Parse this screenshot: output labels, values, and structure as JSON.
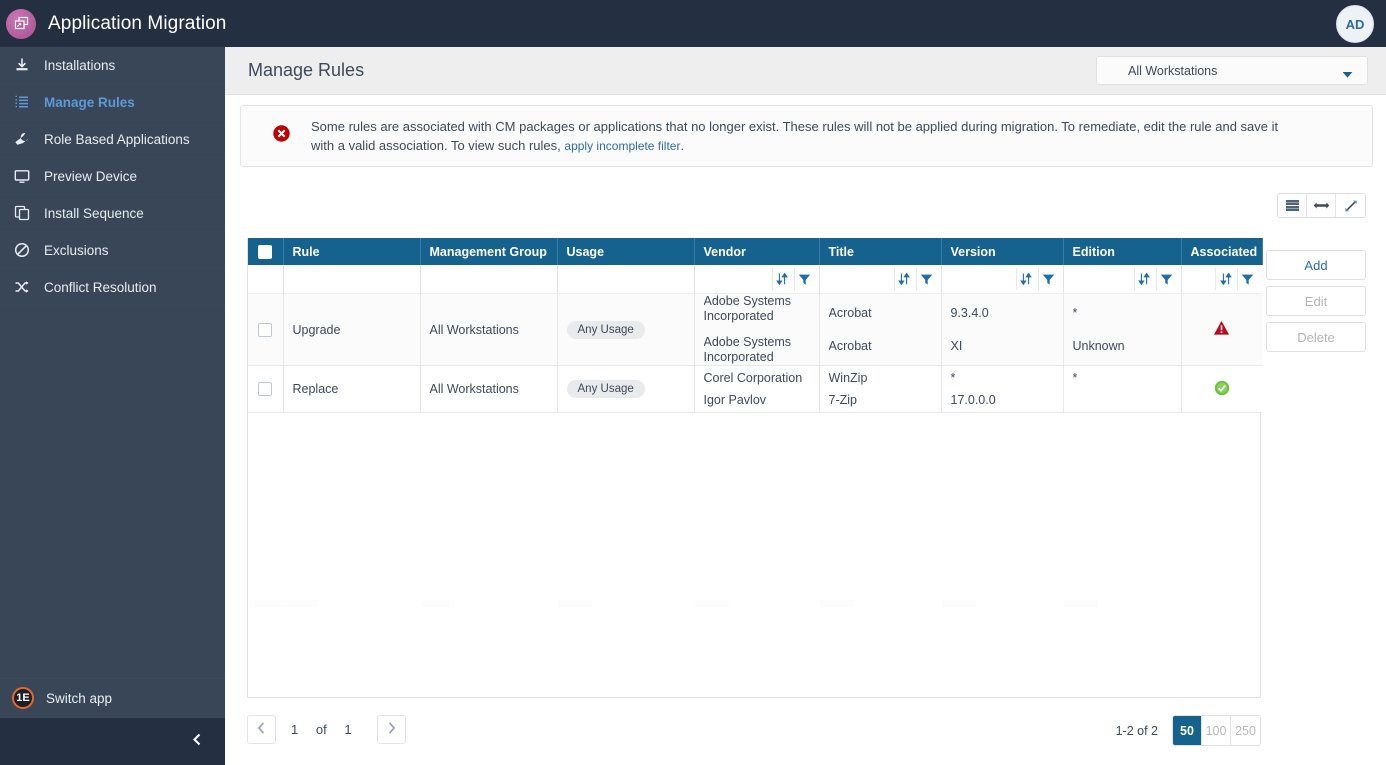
{
  "app": {
    "title": "Application Migration",
    "logo_icon": "app-windows-arrow-icon",
    "avatar_initials": "AD"
  },
  "sidebar": {
    "items": [
      {
        "label": "Installations",
        "icon": "download-icon",
        "active": false
      },
      {
        "label": "Manage Rules",
        "icon": "list-ordered-icon",
        "active": true
      },
      {
        "label": "Role Based Applications",
        "icon": "wrench-icon",
        "active": false
      },
      {
        "label": "Preview Device",
        "icon": "monitor-icon",
        "active": false
      },
      {
        "label": "Install Sequence",
        "icon": "copy-icon",
        "active": false
      },
      {
        "label": "Exclusions",
        "icon": "ban-icon",
        "active": false
      },
      {
        "label": "Conflict Resolution",
        "icon": "shuffle-icon",
        "active": false
      }
    ],
    "switch_app": {
      "label": "Switch app",
      "icon": "one-e-logo-icon",
      "badge": "1E"
    },
    "collapse_icon": "chevron-left-icon"
  },
  "header": {
    "page_title": "Manage Rules",
    "scope_select": {
      "value": "All Workstations",
      "caret_icon": "chevron-down-icon"
    }
  },
  "alert": {
    "icon": "error-circle-icon",
    "message": "Some rules are associated with CM packages or applications that no longer exist. These rules will not be applied during migration. To remediate, edit the rule and save it with a valid association. To view such rules,",
    "link_text": "apply incomplete filter",
    "trailing": "."
  },
  "grid_tools": [
    {
      "name": "column-chooser-icon",
      "icon": "hamburger-lines-icon"
    },
    {
      "name": "fit-columns-icon",
      "icon": "horizontal-arrows-icon"
    },
    {
      "name": "fullscreen-icon",
      "icon": "diagonal-arrows-icon"
    }
  ],
  "actions": [
    {
      "label": "Add",
      "disabled": false
    },
    {
      "label": "Edit",
      "disabled": true
    },
    {
      "label": "Delete",
      "disabled": true
    }
  ],
  "table": {
    "select_all_checkbox": false,
    "columns": [
      {
        "key": "rule",
        "label": "Rule",
        "sortable": false,
        "filterable": false
      },
      {
        "key": "mg",
        "label": "Management Group",
        "sortable": false,
        "filterable": false
      },
      {
        "key": "usage",
        "label": "Usage",
        "sortable": false,
        "filterable": false
      },
      {
        "key": "vendor",
        "label": "Vendor",
        "sortable": true,
        "filterable": true
      },
      {
        "key": "title",
        "label": "Title",
        "sortable": true,
        "filterable": true
      },
      {
        "key": "version",
        "label": "Version",
        "sortable": true,
        "filterable": true
      },
      {
        "key": "edition",
        "label": "Edition",
        "sortable": true,
        "filterable": true
      },
      {
        "key": "assoc",
        "label": "Associated",
        "sortable": true,
        "filterable": true
      }
    ],
    "sort_icon": "sort-updown-icon",
    "filter_icon": "funnel-icon",
    "rows": [
      {
        "checked": false,
        "rule": "Upgrade",
        "management_group": "All Workstations",
        "usage": "Any Usage",
        "vendors": [
          "Adobe Systems Incorporated",
          "Adobe Systems Incorporated"
        ],
        "titles": [
          "Acrobat",
          "Acrobat"
        ],
        "versions": [
          "9.3.4.0",
          "XI"
        ],
        "editions": [
          "*",
          "Unknown"
        ],
        "associated_status": "warning",
        "associated_icon": "warning-triangle-icon"
      },
      {
        "checked": false,
        "rule": "Replace",
        "management_group": "All Workstations",
        "usage": "Any Usage",
        "vendors": [
          "Corel Corporation",
          "Igor Pavlov"
        ],
        "titles": [
          "WinZip",
          "7-Zip"
        ],
        "versions": [
          "*",
          "17.0.0.0"
        ],
        "editions": [
          "*",
          ""
        ],
        "associated_status": "ok",
        "associated_icon": "check-circle-icon"
      }
    ]
  },
  "pagination": {
    "prev_icon": "chevron-left-icon",
    "next_icon": "chevron-right-icon",
    "current_page": "1",
    "of_label": "of",
    "total_pages": "1",
    "range_text": "1-2 of 2",
    "page_sizes": [
      {
        "label": "50",
        "active": true
      },
      {
        "label": "100",
        "active": false
      },
      {
        "label": "250",
        "active": false
      }
    ]
  },
  "colors": {
    "topbar": "#242f42",
    "sidebar": "#394658",
    "accent_blue": "#16628f",
    "link_blue": "#2e6da4",
    "active_nav": "#5b9bd5",
    "error_red": "#c00000",
    "success_green": "#6cbf40",
    "brand_magenta": "#a8528f",
    "brand_orange": "#e8682a"
  }
}
